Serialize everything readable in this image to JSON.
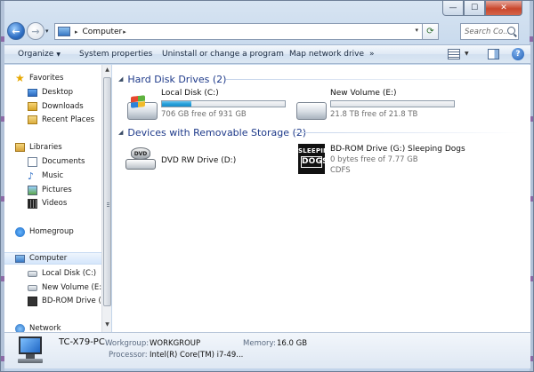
{
  "window": {
    "caption": {
      "minimize": "—",
      "maximize": "☐",
      "close": "✕"
    }
  },
  "address_bar": {
    "breadcrumb": "Computer",
    "separator": "▸",
    "dropdown": "▾",
    "search_placeholder": "Search Co..."
  },
  "command_bar": {
    "organize": "Organize",
    "system_properties": "System properties",
    "uninstall": "Uninstall or change a program",
    "map_drive": "Map network drive",
    "more": "»"
  },
  "nav_pane": {
    "favorites": "Favorites",
    "desktop": "Desktop",
    "downloads": "Downloads",
    "recent_places": "Recent Places",
    "libraries": "Libraries",
    "documents": "Documents",
    "music": "Music",
    "pictures": "Pictures",
    "videos": "Videos",
    "homegroup": "Homegroup",
    "computer": "Computer",
    "local_disk": "Local Disk (C:)",
    "new_volume": "New Volume (E:)",
    "bdrom": "BD-ROM Drive (C",
    "network": "Network"
  },
  "content": {
    "hdd_group": "Hard Disk Drives (2)",
    "removable_group": "Devices with Removable Storage (2)",
    "drives": [
      {
        "name": "Local Disk (C:)",
        "free": "706 GB free of 931 GB",
        "used_fraction": 0.24
      },
      {
        "name": "New Volume (E:)",
        "free": "21.8 TB free of 21.8 TB",
        "used_fraction": 0.0
      }
    ],
    "removable": [
      {
        "name": "DVD RW Drive (D:)",
        "disc_label": "DVD"
      },
      {
        "name": "BD-ROM Drive (G:) Sleeping Dogs",
        "free": "0 bytes free of 7.77 GB",
        "fs": "CDFS",
        "art_top": "SLEEPING",
        "art_bottom": "DOGS"
      }
    ]
  },
  "details": {
    "pc_name": "TC-X79-PC",
    "workgroup_label": "Workgroup:",
    "workgroup": "WORKGROUP",
    "memory_label": "Memory:",
    "memory": "16.0 GB",
    "processor_label": "Processor:",
    "processor": "Intel(R) Core(TM) i7-49..."
  },
  "colors": {
    "group_header": "#1e3a8a",
    "bar_fill": "#26a0da",
    "accent": "#2f6fc4"
  }
}
